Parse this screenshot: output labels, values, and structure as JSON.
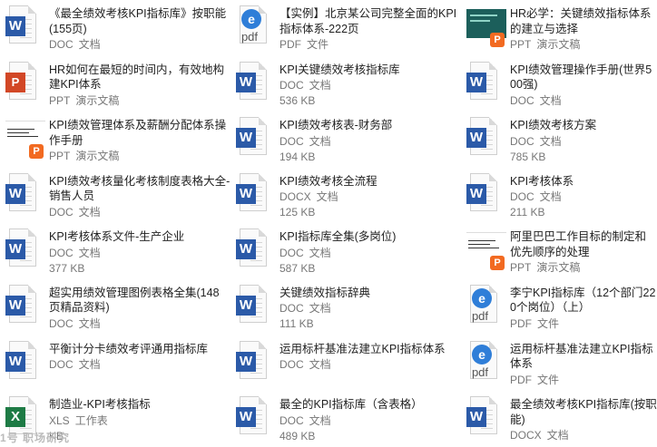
{
  "items": [
    {
      "title": "《最全绩效考核KPI指标库》按职能(155页)",
      "type": "DOC",
      "kind": "文档",
      "size": "",
      "icon": "doc-icon",
      "ic": "doc"
    },
    {
      "title": "【实例】北京某公司完整全面的KPI指标体系-222页",
      "type": "PDF",
      "kind": "文件",
      "size": "",
      "icon": "pdf-icon",
      "ic": "pdf"
    },
    {
      "title": "HR必学：关键绩效指标体系的建立与选择",
      "type": "PPT",
      "kind": "演示文稿",
      "size": "",
      "icon": "ppt-thumbnail-icon",
      "ic": "thumb-teal"
    },
    {
      "title": "HR如何在最短的时间内，有效地构建KPI体系",
      "type": "PPT",
      "kind": "演示文稿",
      "size": "",
      "icon": "ppt-icon",
      "ic": "ppt"
    },
    {
      "title": "KPI关键绩效考核指标库",
      "type": "DOC",
      "kind": "文档",
      "size": "536 KB",
      "icon": "doc-icon",
      "ic": "doc"
    },
    {
      "title": "KPI绩效管理操作手册(世界500强)",
      "type": "DOC",
      "kind": "文档",
      "size": "",
      "icon": "doc-icon",
      "ic": "doc"
    },
    {
      "title": "KPI绩效管理体系及薪酬分配体系操作手册",
      "type": "PPT",
      "kind": "演示文稿",
      "size": "",
      "icon": "ppt-thumbnail-icon",
      "ic": "thumb-white"
    },
    {
      "title": "KPI绩效考核表-财务部",
      "type": "DOC",
      "kind": "文档",
      "size": "194 KB",
      "icon": "doc-icon",
      "ic": "doc"
    },
    {
      "title": "KPI绩效考核方案",
      "type": "DOC",
      "kind": "文档",
      "size": "785 KB",
      "icon": "doc-icon",
      "ic": "doc"
    },
    {
      "title": "KPI绩效考核量化考核制度表格大全-销售人员",
      "type": "DOC",
      "kind": "文档",
      "size": "",
      "icon": "doc-icon",
      "ic": "doc"
    },
    {
      "title": "KPI绩效考核全流程",
      "type": "DOCX",
      "kind": "文档",
      "size": "125 KB",
      "icon": "doc-icon",
      "ic": "doc"
    },
    {
      "title": "KPI考核体系",
      "type": "DOC",
      "kind": "文档",
      "size": "211 KB",
      "icon": "doc-icon",
      "ic": "doc"
    },
    {
      "title": "KPI考核体系文件-生产企业",
      "type": "DOC",
      "kind": "文档",
      "size": "377 KB",
      "icon": "doc-icon",
      "ic": "doc"
    },
    {
      "title": "KPI指标库全集(多岗位)",
      "type": "DOC",
      "kind": "文档",
      "size": "587 KB",
      "icon": "doc-icon",
      "ic": "doc"
    },
    {
      "title": "阿里巴巴工作目标的制定和优先顺序的处理",
      "type": "PPT",
      "kind": "演示文稿",
      "size": "",
      "icon": "ppt-thumbnail-icon",
      "ic": "thumb-white"
    },
    {
      "title": "超实用绩效管理图例表格全集(148页精品资料)",
      "type": "DOC",
      "kind": "文档",
      "size": "",
      "icon": "doc-icon",
      "ic": "doc"
    },
    {
      "title": "关键绩效指标辞典",
      "type": "DOC",
      "kind": "文档",
      "size": "111 KB",
      "icon": "doc-icon",
      "ic": "doc"
    },
    {
      "title": "李宁KPI指标库（12个部门220个岗位）（上）",
      "type": "PDF",
      "kind": "文件",
      "size": "",
      "icon": "pdf-icon",
      "ic": "pdf"
    },
    {
      "title": "平衡计分卡绩效考评通用指标库",
      "type": "DOC",
      "kind": "文档",
      "size": "",
      "icon": "doc-icon",
      "ic": "doc"
    },
    {
      "title": "运用标杆基准法建立KPI指标体系",
      "type": "DOC",
      "kind": "文档",
      "size": "",
      "icon": "doc-icon",
      "ic": "doc"
    },
    {
      "title": "运用标杆基准法建立KPI指标体系",
      "type": "PDF",
      "kind": "文件",
      "size": "",
      "icon": "pdf-icon",
      "ic": "pdf"
    },
    {
      "title": "制造业-KPI考核指标",
      "type": "XLS",
      "kind": "工作表",
      "size": "KB",
      "icon": "xls-icon",
      "ic": "xls"
    },
    {
      "title": "最全的KPI指标库（含表格）",
      "type": "DOC",
      "kind": "文档",
      "size": "489 KB",
      "icon": "doc-icon",
      "ic": "doc"
    },
    {
      "title": "最全绩效考核KPI指标库(按职能)",
      "type": "DOCX",
      "kind": "文档",
      "size": "",
      "icon": "doc-icon",
      "ic": "doc"
    }
  ],
  "watermark": "1号 职场研究"
}
